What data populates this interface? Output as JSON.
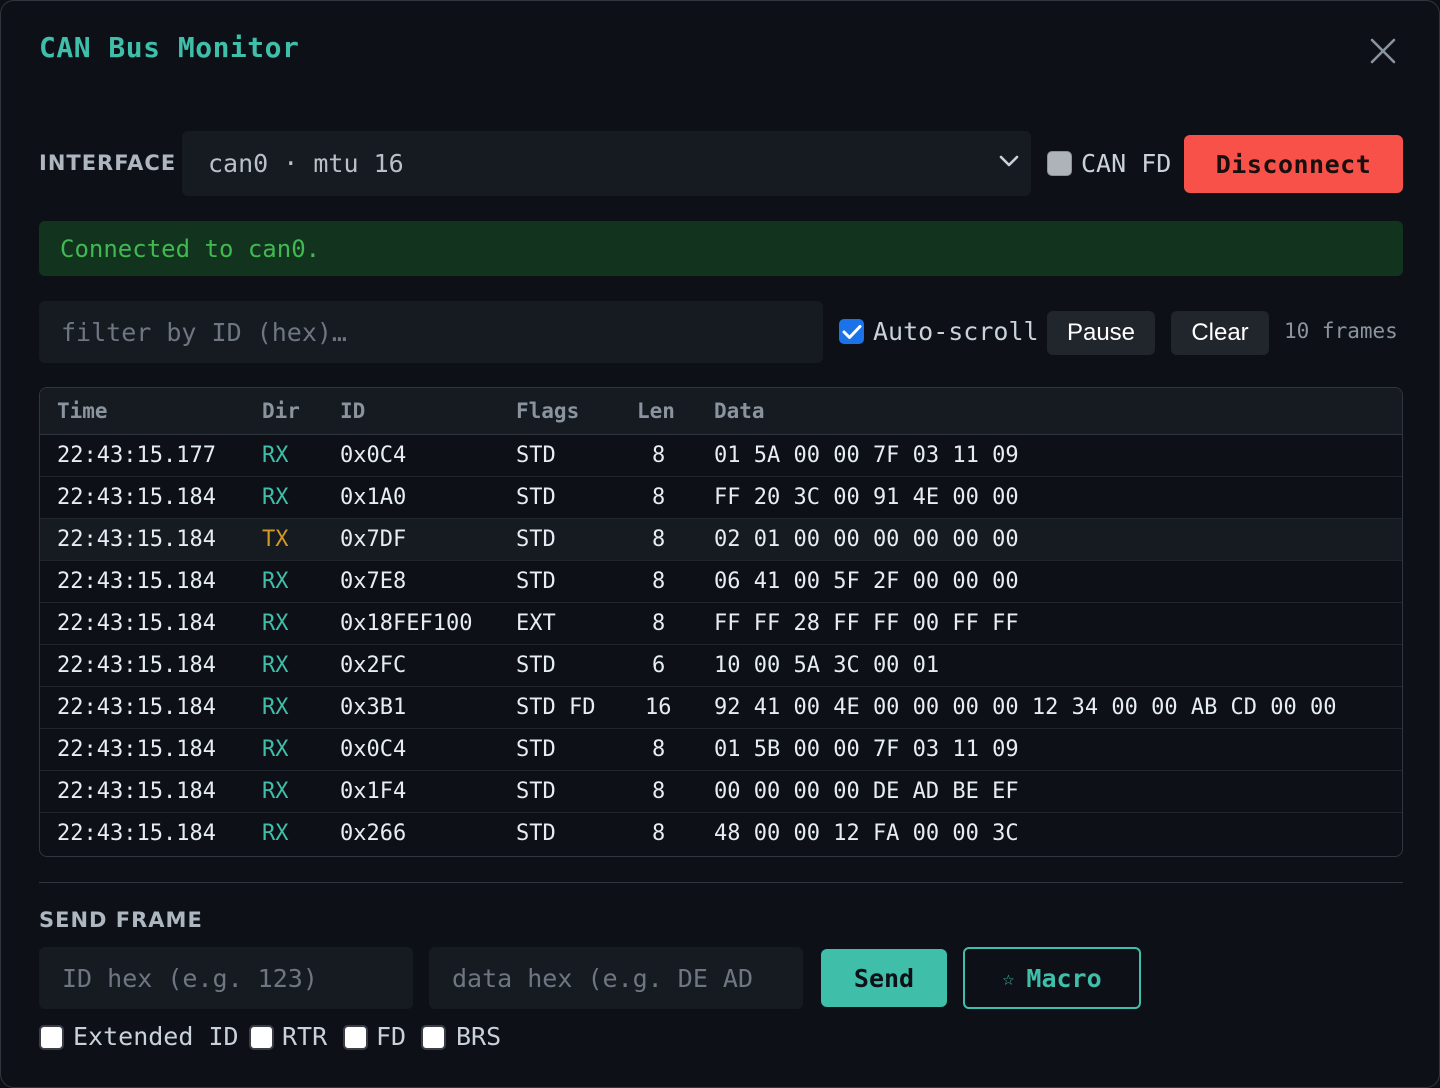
{
  "window": {
    "title": "CAN Bus Monitor"
  },
  "connection": {
    "interface_label": "INTERFACE",
    "interface_value": "can0 · mtu 16",
    "canfd_label": "CAN FD",
    "canfd_checked": false,
    "disconnect_label": "Disconnect",
    "status_text": "Connected to can0."
  },
  "toolbar": {
    "filter_placeholder": "filter by ID (hex)…",
    "autoscroll_label": "Auto-scroll",
    "autoscroll_checked": true,
    "pause_label": "Pause",
    "clear_label": "Clear",
    "frame_count": "10 frames"
  },
  "table": {
    "headers": [
      "Time",
      "Dir",
      "ID",
      "Flags",
      "Len",
      "Data"
    ],
    "rows": [
      {
        "time": "22:43:15.177",
        "dir": "RX",
        "id": "0x0C4",
        "flags": "STD",
        "len": "8",
        "data": "01 5A 00 00 7F 03 11 09"
      },
      {
        "time": "22:43:15.184",
        "dir": "RX",
        "id": "0x1A0",
        "flags": "STD",
        "len": "8",
        "data": "FF 20 3C 00 91 4E 00 00"
      },
      {
        "time": "22:43:15.184",
        "dir": "TX",
        "id": "0x7DF",
        "flags": "STD",
        "len": "8",
        "data": "02 01 00 00 00 00 00 00"
      },
      {
        "time": "22:43:15.184",
        "dir": "RX",
        "id": "0x7E8",
        "flags": "STD",
        "len": "8",
        "data": "06 41 00 5F 2F 00 00 00"
      },
      {
        "time": "22:43:15.184",
        "dir": "RX",
        "id": "0x18FEF100",
        "flags": "EXT",
        "len": "8",
        "data": "FF FF 28 FF FF 00 FF FF"
      },
      {
        "time": "22:43:15.184",
        "dir": "RX",
        "id": "0x2FC",
        "flags": "STD",
        "len": "6",
        "data": "10 00 5A 3C 00 01"
      },
      {
        "time": "22:43:15.184",
        "dir": "RX",
        "id": "0x3B1",
        "flags": "STD FD",
        "len": "16",
        "data": "92 41 00 4E 00 00 00 00 12 34 00 00 AB CD 00 00"
      },
      {
        "time": "22:43:15.184",
        "dir": "RX",
        "id": "0x0C4",
        "flags": "STD",
        "len": "8",
        "data": "01 5B 00 00 7F 03 11 09"
      },
      {
        "time": "22:43:15.184",
        "dir": "RX",
        "id": "0x1F4",
        "flags": "STD",
        "len": "8",
        "data": "00 00 00 00 DE AD BE EF"
      },
      {
        "time": "22:43:15.184",
        "dir": "RX",
        "id": "0x266",
        "flags": "STD",
        "len": "8",
        "data": "48 00 00 12 FA 00 00 3C"
      }
    ]
  },
  "send": {
    "section_label": "SEND FRAME",
    "id_placeholder": "ID hex (e.g. 123)",
    "data_placeholder": "data hex (e.g. DE AD",
    "send_label": "Send",
    "macro_label": "Macro",
    "options": [
      {
        "label": "Extended ID",
        "checked": false
      },
      {
        "label": "RTR",
        "checked": false
      },
      {
        "label": "FD",
        "checked": false
      },
      {
        "label": "BRS",
        "checked": false
      }
    ]
  },
  "colors": {
    "accent": "#3fbfaa",
    "danger": "#f85149",
    "tx": "#d29922",
    "success": "#3fb950"
  }
}
